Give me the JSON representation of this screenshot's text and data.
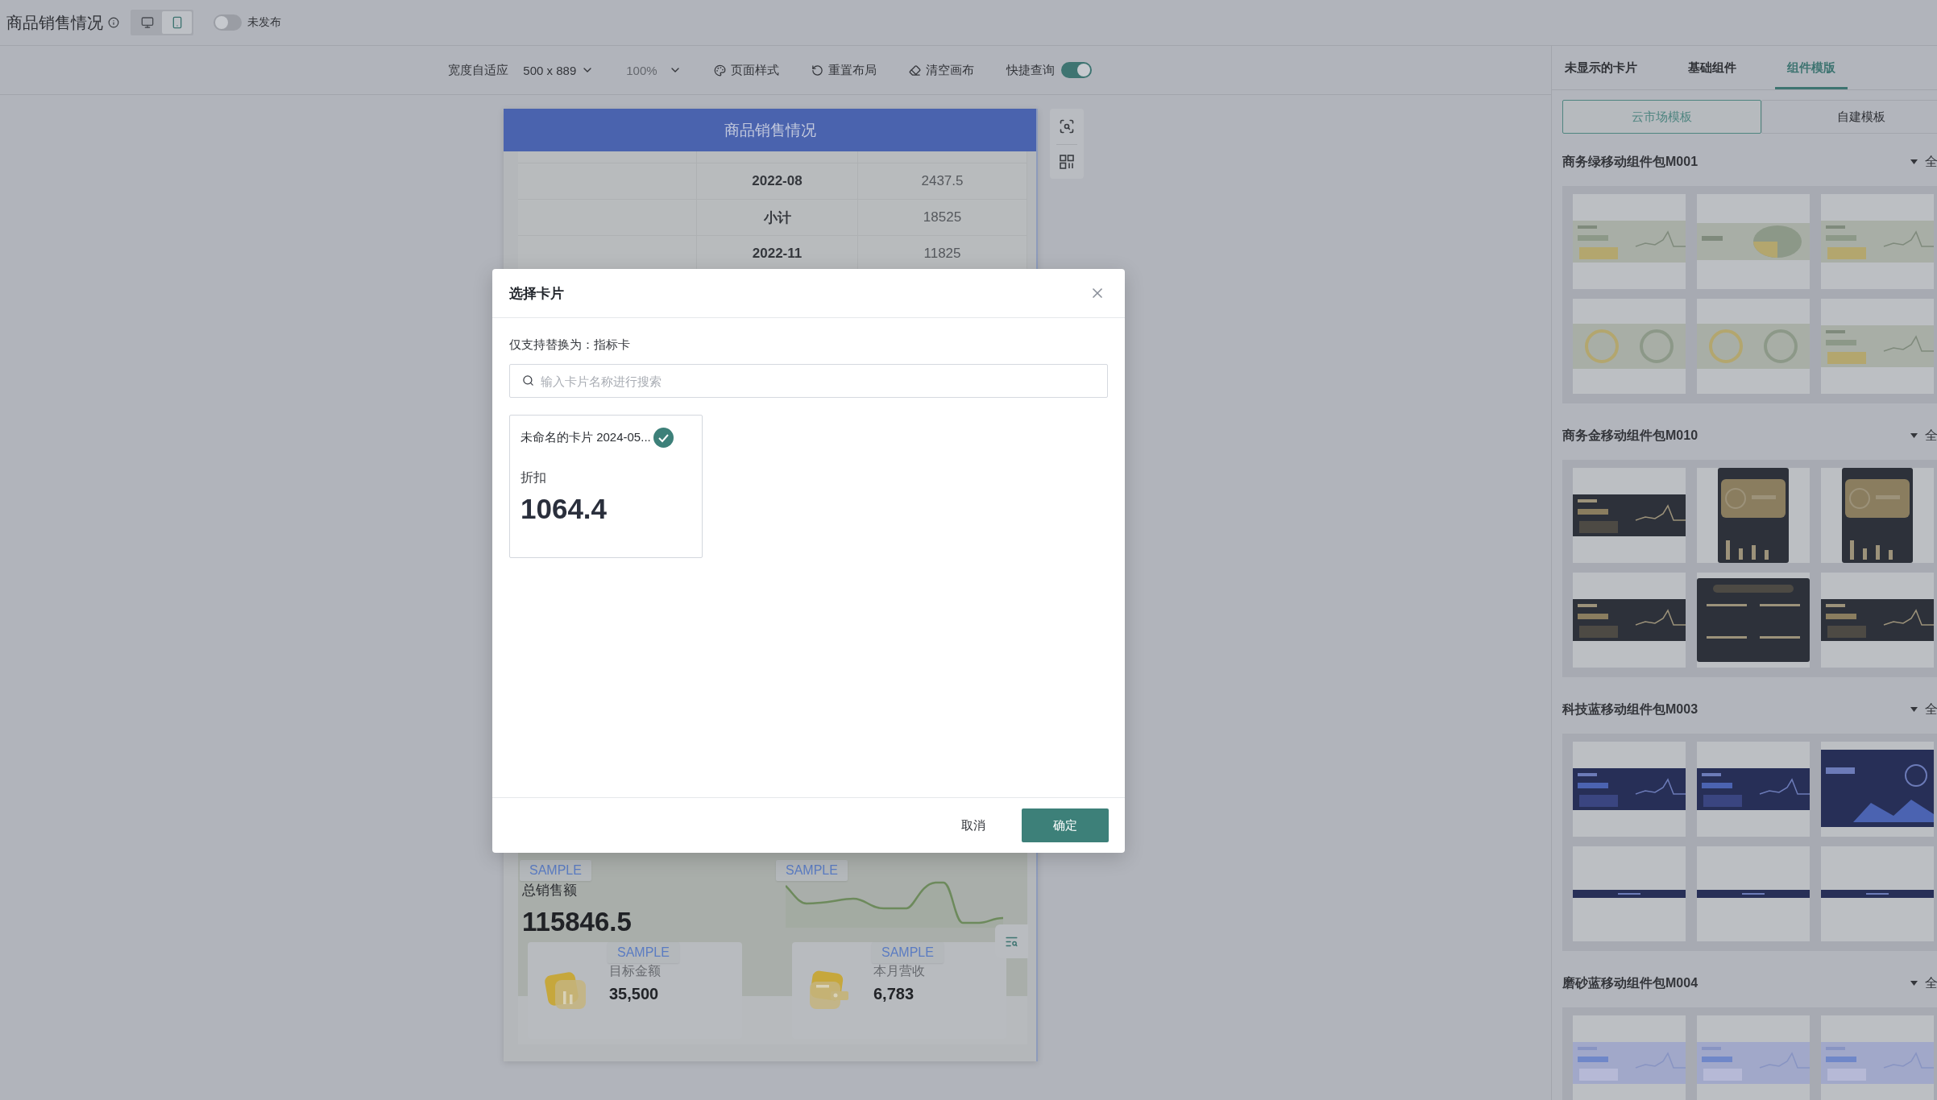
{
  "header": {
    "title": "商品销售情况",
    "view_modes": [
      {
        "kind": "desktop",
        "selected": false
      },
      {
        "kind": "mobile",
        "selected": true
      }
    ],
    "publish": {
      "label": "未发布",
      "on": false
    }
  },
  "toolbar": {
    "width_mode": "宽度自适应",
    "size": "500 x 889",
    "zoom": {
      "value": "100%",
      "disabled": true
    },
    "actions": [
      {
        "kind": "palette",
        "label": "页面样式"
      },
      {
        "kind": "reset",
        "label": "重置布局"
      },
      {
        "kind": "eraser",
        "label": "清空画布"
      }
    ],
    "quick_query": {
      "label": "快捷查询",
      "on": true
    }
  },
  "canvas": {
    "title": "商品销售情况",
    "table": {
      "rows": [
        {
          "period": "2022-08",
          "value": "2437.5"
        },
        {
          "period": "小计",
          "value": "18525"
        },
        {
          "period": "2022-11",
          "value": "11825"
        }
      ]
    },
    "kpi": {
      "badge": "SAMPLE",
      "label": "总销售额",
      "value": "115846.5",
      "chart_badge": "SAMPLE"
    },
    "cards": [
      {
        "kind": "chart",
        "badge": "SAMPLE",
        "label": "目标金额",
        "value": "35,500"
      },
      {
        "kind": "wallet",
        "badge": "SAMPLE",
        "label": "本月营收",
        "value": "6,783"
      }
    ]
  },
  "dialog": {
    "title": "选择卡片",
    "hint": "仅支持替换为：指标卡",
    "search": {
      "placeholder": "输入卡片名称进行搜索"
    },
    "cards": [
      {
        "title": "未命名的卡片 2024-05...",
        "metric": "折扣",
        "value": "1064.4",
        "selected": true
      }
    ],
    "buttons": [
      {
        "kind": "secondary",
        "label": "取消"
      },
      {
        "kind": "primary",
        "label": "确定"
      }
    ]
  },
  "panel": {
    "tabs": [
      {
        "label": "未显示的卡片",
        "selected": false
      },
      {
        "label": "基础组件",
        "selected": false
      },
      {
        "label": "组件模版",
        "selected": true
      }
    ],
    "sources": [
      {
        "label": "云市场模板",
        "selected": true
      },
      {
        "label": "自建模板",
        "selected": false
      }
    ],
    "packs": [
      {
        "name": "商务绿移动组件包M001",
        "expanded": true,
        "link": "全",
        "kind": "sage",
        "templates": [
          {
            "kind": "banner"
          },
          {
            "kind": "pie"
          },
          {
            "kind": "banner"
          },
          {
            "kind": "rings"
          },
          {
            "kind": "rings"
          },
          {
            "kind": "banner"
          }
        ]
      },
      {
        "name": "商务金移动组件包M010",
        "expanded": true,
        "link": "全",
        "kind": "gold",
        "templates": [
          {
            "kind": "banner"
          },
          {
            "kind": "tall"
          },
          {
            "kind": "tall"
          },
          {
            "kind": "banner"
          },
          {
            "kind": "block"
          },
          {
            "kind": "banner"
          }
        ]
      },
      {
        "name": "科技蓝移动组件包M003",
        "expanded": true,
        "link": "全",
        "kind": "navy",
        "templates": [
          {
            "kind": "banner"
          },
          {
            "kind": "banner"
          },
          {
            "kind": "panel"
          },
          {
            "kind": "strip"
          },
          {
            "kind": "strip"
          },
          {
            "kind": "strip"
          }
        ]
      },
      {
        "name": "磨砂蓝移动组件包M004",
        "expanded": true,
        "link": "全",
        "kind": "frost",
        "templates": [
          {
            "kind": "banner"
          },
          {
            "kind": "banner"
          },
          {
            "kind": "banner"
          }
        ]
      }
    ]
  }
}
